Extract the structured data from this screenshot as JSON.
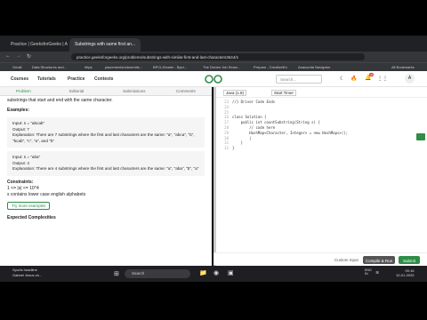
{
  "browser": {
    "tabs": [
      "Practice | GeeksforGeeks | A c...",
      "Substrings with same first an..."
    ],
    "url": "practice.geeksforgeeks.org/problems/substrings-with-similar-first-and-last-characters3644/1",
    "bookmarks": [
      "Gmail",
      "Data Structures and...",
      "https",
      "placements/cdommits...",
      "BPCL/Dealer - Bpcl...",
      "The Dream Job Searc...",
      "Prepare - CreativeEd",
      "Anaconda Navigator",
      "All Bookmarks"
    ]
  },
  "site": {
    "nav": [
      "Courses",
      "Tutorials",
      "Practice",
      "Contests"
    ],
    "search_placeholder": "Search...",
    "notif_count": "40",
    "avatar": "A"
  },
  "problem": {
    "tabs": [
      "Problem",
      "Editorial",
      "Submissions",
      "Comments"
    ],
    "intro": "substrings that start and end with the same character.",
    "examples_heading": "Examples:",
    "example1": {
      "input": "Input: s = \"abcab\"",
      "output": "Output: 7",
      "explanation": "Explanation: There are 7 substrings where the first and last characters are the same: \"a\", \"abca\", \"b\", \"bcab\", \"c\", \"a\", and \"b\""
    },
    "example2": {
      "input": "Input: s = \"aba\"",
      "output": "Output: 4",
      "explanation": "Explanation: There are 4 substrings where the first and last characters are the same: \"a\", \"aba\", \"b\", \"a\""
    },
    "constraints_heading": "Constraints:",
    "constraint1": "1 <= |s| <= 10^4",
    "constraint2": "s contains lower case english alphabets",
    "try_more": "Try more examples",
    "expected_complexities": "Expected Complexities"
  },
  "editor": {
    "language": "Java (1.8)",
    "timer": "Start Timer",
    "lines": [
      {
        "n": "23",
        "code": "//} Driver Code Ends"
      },
      {
        "n": "24",
        "code": ""
      },
      {
        "n": "25",
        "code": ""
      },
      {
        "n": "26",
        "code": "class Solution {"
      },
      {
        "n": "27",
        "code": "    public int countSubstring(String s) {"
      },
      {
        "n": "28",
        "code": "        // code here"
      },
      {
        "n": "29",
        "code": "        HashMap<Character, Integer> = new HashMap<>();"
      },
      {
        "n": "30",
        "code": "        |"
      },
      {
        "n": "31",
        "code": "    }"
      },
      {
        "n": "32",
        "code": "}"
      }
    ],
    "custom_input": "Custom Input",
    "compile_run": "Compile & Run",
    "submit": "Submit"
  },
  "taskbar": {
    "weather_title": "Sports headline",
    "weather_sub": "Gabriel Jesus ch...",
    "search": "Search",
    "lang": "ENG IN",
    "time": "09:16",
    "date": "10-01-2025"
  }
}
